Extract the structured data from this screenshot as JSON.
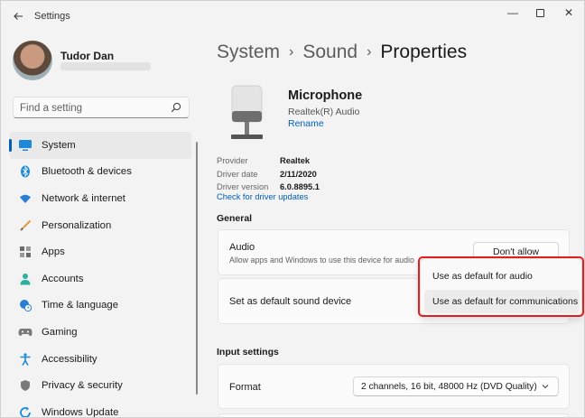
{
  "window": {
    "title": "Settings",
    "controls": {
      "minimize": "—",
      "close": "✕"
    }
  },
  "user": {
    "name": "Tudor Dan"
  },
  "search": {
    "placeholder": "Find a setting"
  },
  "sidebar": {
    "items": [
      {
        "label": "System",
        "icon": "monitor-icon",
        "active": true
      },
      {
        "label": "Bluetooth & devices",
        "icon": "bluetooth-icon"
      },
      {
        "label": "Network & internet",
        "icon": "wifi-icon"
      },
      {
        "label": "Personalization",
        "icon": "brush-icon"
      },
      {
        "label": "Apps",
        "icon": "apps-icon"
      },
      {
        "label": "Accounts",
        "icon": "person-icon"
      },
      {
        "label": "Time & language",
        "icon": "clock-globe-icon"
      },
      {
        "label": "Gaming",
        "icon": "gamepad-icon"
      },
      {
        "label": "Accessibility",
        "icon": "accessibility-icon"
      },
      {
        "label": "Privacy & security",
        "icon": "shield-icon"
      },
      {
        "label": "Windows Update",
        "icon": "update-icon"
      }
    ]
  },
  "breadcrumb": {
    "part1": "System",
    "part2": "Sound",
    "current": "Properties",
    "separator": "›"
  },
  "device": {
    "name": "Microphone",
    "subtitle": "Realtek(R) Audio",
    "rename": "Rename"
  },
  "properties": {
    "provider_label": "Provider",
    "provider_value": "Realtek",
    "date_label": "Driver date",
    "date_value": "2/11/2020",
    "version_label": "Driver version",
    "version_value": "6.0.8895.1",
    "update_link": "Check for driver updates"
  },
  "general": {
    "title": "General",
    "audio_title": "Audio",
    "audio_desc": "Allow apps and Windows to use this device for audio",
    "dont_allow": "Don't allow",
    "default_device": "Set as default sound device"
  },
  "dropdown": {
    "option1": "Use as default for audio",
    "option2": "Use as default for communications"
  },
  "input_settings": {
    "title": "Input settings",
    "format_label": "Format",
    "format_value": "2 channels, 16 bit, 48000 Hz (DVD Quality)"
  },
  "colors": {
    "accent": "#005fb8",
    "highlight": "#e0201e",
    "background": "#f3f3f3"
  }
}
